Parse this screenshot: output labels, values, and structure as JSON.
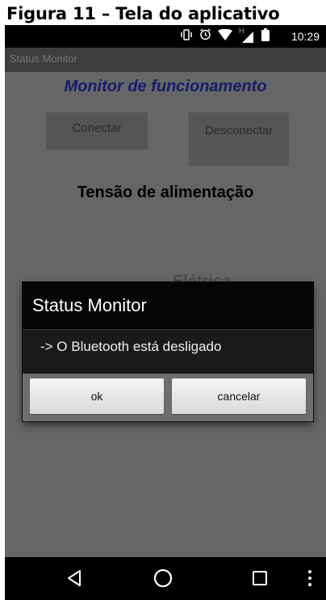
{
  "caption": "Figura 11 – Tela do aplicativo",
  "statusbar": {
    "time": "10:29",
    "network_label": "H",
    "icons": [
      "vibrate-icon",
      "alarm-icon",
      "wifi-icon",
      "signal-icon",
      "battery-icon"
    ]
  },
  "appbar": {
    "title": "Status Monitor"
  },
  "main": {
    "headline": "Monitor de funcionamento",
    "connect_label": "Conectar",
    "disconnect_label": "Desconectar",
    "section_title": "Tensão de alimentação",
    "partial_text": "Elétrica"
  },
  "dialog": {
    "title": "Status Monitor",
    "message": "-> O Bluetooth está desligado",
    "ok_label": "ok",
    "cancel_label": "cancelar"
  },
  "navbar": {
    "items": [
      "back-icon",
      "home-icon",
      "recents-icon",
      "menu-icon"
    ]
  },
  "colors": {
    "headline": "#1a1a6e",
    "app_background": "#666666",
    "dialog_background": "#1a1a1a",
    "dialog_buttons_background": "#6e6e6e"
  }
}
